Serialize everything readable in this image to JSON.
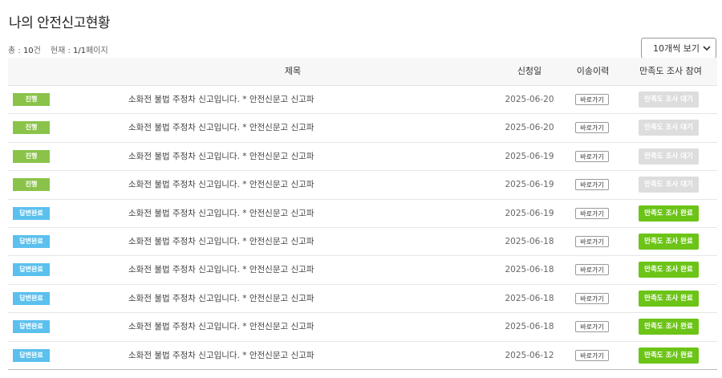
{
  "page": {
    "title": "나의 안전신고현황"
  },
  "summary": {
    "total_label": "총 : ",
    "total_value": "10",
    "total_unit": "건",
    "current_label": "현재 : ",
    "current_value": "1/1",
    "current_unit": "페이지"
  },
  "per_page": {
    "selected": "10개씩 보기"
  },
  "table": {
    "headers": {
      "title": "제목",
      "date": "신청일",
      "history": "이송이력",
      "survey": "만족도 조사 참여"
    },
    "rows": [
      {
        "status": "진행",
        "title": "소화전 불법 주정차 신고입니다. * 안전신문고 신고파",
        "date": "2025-06-20",
        "goto": "바로가기",
        "survey": "만족도 조사 대기"
      },
      {
        "status": "진행",
        "title": "소화전 불법 주정차 신고입니다. * 안전신문고 신고파",
        "date": "2025-06-20",
        "goto": "바로가기",
        "survey": "만족도 조사 대기"
      },
      {
        "status": "진행",
        "title": "소화전 불법 주정차 신고입니다. * 안전신문고 신고파",
        "date": "2025-06-19",
        "goto": "바로가기",
        "survey": "만족도 조사 대기"
      },
      {
        "status": "진행",
        "title": "소화전 불법 주정차 신고입니다. * 안전신문고 신고파",
        "date": "2025-06-19",
        "goto": "바로가기",
        "survey": "만족도 조사 대기"
      },
      {
        "status": "답변완료",
        "title": "소화전 불법 주정차 신고입니다. * 안전신문고 신고파",
        "date": "2025-06-19",
        "goto": "바로가기",
        "survey": "만족도 조사 완료"
      },
      {
        "status": "답변완료",
        "title": "소화전 불법 주정차 신고입니다. * 안전신문고 신고파",
        "date": "2025-06-18",
        "goto": "바로가기",
        "survey": "만족도 조사 완료"
      },
      {
        "status": "답변완료",
        "title": "소화전 불법 주정차 신고입니다. * 안전신문고 신고파",
        "date": "2025-06-18",
        "goto": "바로가기",
        "survey": "만족도 조사 완료"
      },
      {
        "status": "답변완료",
        "title": "소화전 불법 주정차 신고입니다. * 안전신문고 신고파",
        "date": "2025-06-18",
        "goto": "바로가기",
        "survey": "만족도 조사 완료"
      },
      {
        "status": "답변완료",
        "title": "소화전 불법 주정차 신고입니다. * 안전신문고 신고파",
        "date": "2025-06-18",
        "goto": "바로가기",
        "survey": "만족도 조사 완료"
      },
      {
        "status": "답변완료",
        "title": "소화전 불법 주정차 신고입니다. * 안전신문고 신고파",
        "date": "2025-06-12",
        "goto": "바로가기",
        "survey": "만족도 조사 완료"
      }
    ]
  },
  "colors": {
    "status_progress": "#8bc34a",
    "status_done": "#5bc0ee",
    "survey_wait": "#dddddd",
    "survey_complete": "#6cc417"
  },
  "icons": {
    "per_page_toggle": "chevron-down-icon"
  }
}
